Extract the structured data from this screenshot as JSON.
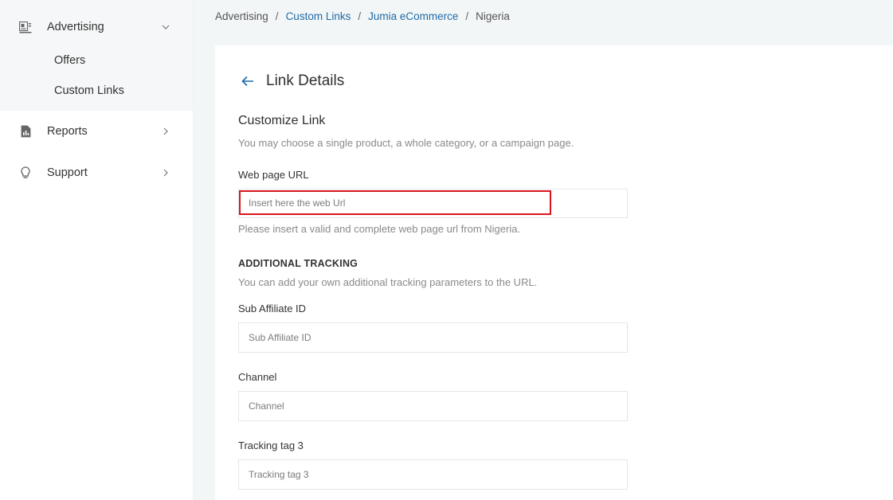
{
  "sidebar": {
    "items": [
      {
        "label": "Advertising",
        "icon": "advertising-icon",
        "expanded": true,
        "children": [
          {
            "label": "Offers"
          },
          {
            "label": "Custom Links"
          }
        ]
      },
      {
        "label": "Reports",
        "icon": "reports-icon"
      },
      {
        "label": "Support",
        "icon": "lightbulb-icon"
      }
    ]
  },
  "breadcrumb": {
    "items": [
      "Advertising",
      "Custom Links",
      "Jumia eCommerce",
      "Nigeria"
    ],
    "separator": "/"
  },
  "page": {
    "title": "Link Details"
  },
  "customize": {
    "title": "Customize Link",
    "subtitle": "You may choose a single product, a whole category, or a campaign page.",
    "url_label": "Web page URL",
    "url_placeholder": "Insert here the web Url",
    "url_hint": "Please insert a valid and complete web page url from Nigeria."
  },
  "tracking": {
    "title": "ADDITIONAL TRACKING",
    "subtitle": "You can add your own additional tracking parameters to the URL.",
    "fields": [
      {
        "label": "Sub Affiliate ID",
        "placeholder": "Sub Affiliate ID"
      },
      {
        "label": "Channel",
        "placeholder": "Channel"
      },
      {
        "label": "Tracking tag 3",
        "placeholder": "Tracking tag 3"
      }
    ]
  },
  "colors": {
    "accent": "#1f6aa5",
    "highlight_border": "#d9161c",
    "sidebar_group_bg": "#f5f7f8",
    "main_bg": "#f3f6f7"
  }
}
